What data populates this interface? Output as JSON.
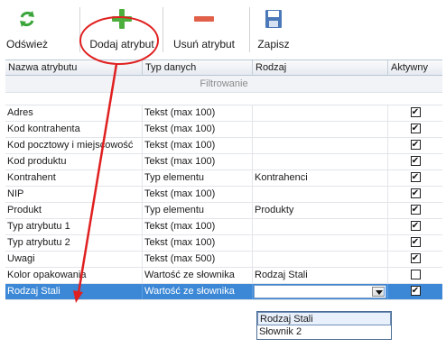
{
  "toolbar": {
    "refresh_label": "Odśwież",
    "add_label": "Dodaj atrybut",
    "remove_label": "Usuń atrybut",
    "save_label": "Zapisz"
  },
  "grid": {
    "columns": [
      "Nazwa atrybutu",
      "Typ danych",
      "Rodzaj",
      "Aktywny"
    ],
    "group_label": "Filtrowanie",
    "rows": [
      {
        "name": "Adres",
        "type": "Tekst (max 100)",
        "kind": "",
        "active": true
      },
      {
        "name": "Kod kontrahenta",
        "type": "Tekst (max 100)",
        "kind": "",
        "active": true
      },
      {
        "name": "Kod pocztowy i miejscowość",
        "type": "Tekst (max 100)",
        "kind": "",
        "active": true
      },
      {
        "name": "Kod produktu",
        "type": "Tekst (max 100)",
        "kind": "",
        "active": true
      },
      {
        "name": "Kontrahent",
        "type": "Typ elementu",
        "kind": "Kontrahenci",
        "active": true
      },
      {
        "name": "NIP",
        "type": "Tekst (max 100)",
        "kind": "",
        "active": true
      },
      {
        "name": "Produkt",
        "type": "Typ elementu",
        "kind": "Produkty",
        "active": true
      },
      {
        "name": "Typ atrybutu 1",
        "type": "Tekst (max 100)",
        "kind": "",
        "active": true
      },
      {
        "name": "Typ atrybutu 2",
        "type": "Tekst (max 100)",
        "kind": "",
        "active": true
      },
      {
        "name": "Uwagi",
        "type": "Tekst (max 500)",
        "kind": "",
        "active": true
      },
      {
        "name": "Kolor opakowania",
        "type": "Wartość ze słownika",
        "kind": "Rodzaj Stali",
        "active": false
      },
      {
        "name": "Rodzaj Stali",
        "type": "Wartość ze słownika",
        "kind": "",
        "active": true
      }
    ],
    "dropdown_options": [
      "Rodzaj Stali",
      "Słownik 2"
    ]
  },
  "colors": {
    "selection": "#3c88d6",
    "annotation": "#e02020",
    "add_icon": "#4caf3c",
    "remove_icon": "#e0604a",
    "refresh_icon": "#3aa53a",
    "save_icon": "#4a78b8"
  }
}
